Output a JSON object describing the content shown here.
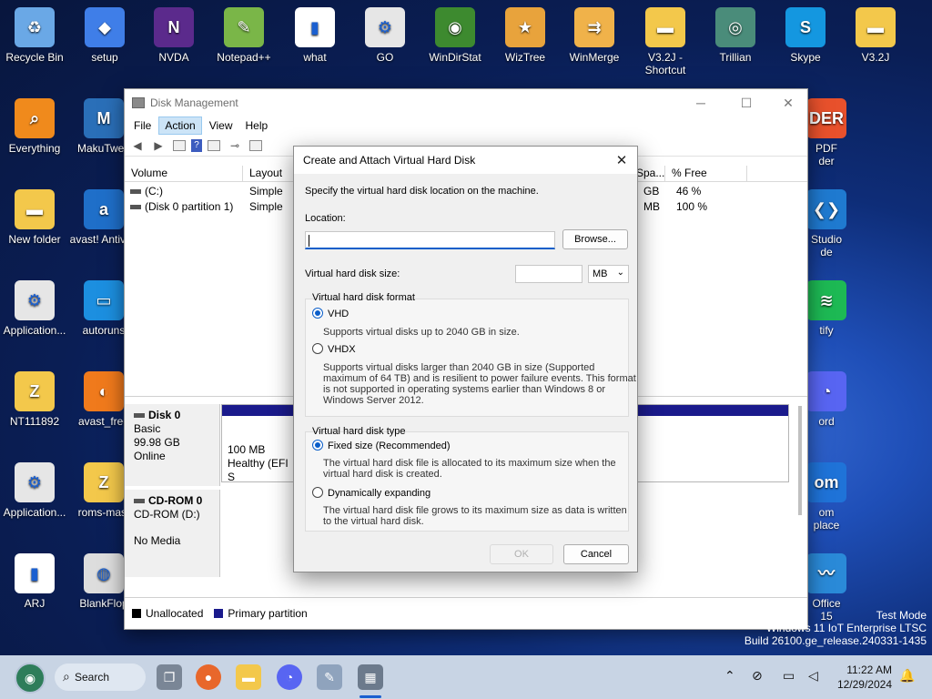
{
  "desktop": {
    "icons_top": [
      {
        "label": "Recycle Bin",
        "glyph": "♻",
        "color": "#6aa8e6"
      },
      {
        "label": "setup",
        "glyph": "◆",
        "color": "#3f7ee8"
      },
      {
        "label": "NVDA",
        "glyph": "N",
        "color": "#5b2a8c"
      },
      {
        "label": "Notepad++",
        "glyph": "✎",
        "color": "#7ab648"
      },
      {
        "label": "what",
        "glyph": "▮",
        "color": "#ffffff"
      },
      {
        "label": "GO",
        "glyph": "⚙",
        "color": "#e6e6e6"
      },
      {
        "label": "WinDirStat",
        "glyph": "◉",
        "color": "#3d8a2f"
      },
      {
        "label": "WizTree",
        "glyph": "★",
        "color": "#e8a33c"
      },
      {
        "label": "WinMerge",
        "glyph": "⇉",
        "color": "#f0b24a"
      },
      {
        "label": "V3.2J - Shortcut",
        "glyph": "▬",
        "color": "#f3c84b"
      },
      {
        "label": "Trillian",
        "glyph": "◎",
        "color": "#4a8c7a"
      },
      {
        "label": "Skype",
        "glyph": "S",
        "color": "#1497e0"
      },
      {
        "label": "V3.2J",
        "glyph": "▬",
        "color": "#f3c84b"
      }
    ],
    "icons_left": [
      {
        "label": "Everything",
        "glyph": "⌕",
        "color": "#f08a1c"
      },
      {
        "label": "MakuTwea",
        "glyph": "M",
        "color": "#2a6fb8"
      },
      {
        "label": "New folder",
        "glyph": "▬",
        "color": "#f3c84b"
      },
      {
        "label": "avast! Antiviru",
        "glyph": "a",
        "color": "#1f6fc9"
      },
      {
        "label": "Application...",
        "glyph": "⚙",
        "color": "#e6e6e6"
      },
      {
        "label": "autoruns",
        "glyph": "▭",
        "color": "#1c8fe0"
      },
      {
        "label": "NT111892",
        "glyph": "Z",
        "color": "#f3c84b"
      },
      {
        "label": "avast_free",
        "glyph": "◐",
        "color": "#f07a1c"
      },
      {
        "label": "Application...",
        "glyph": "⚙",
        "color": "#e6e6e6"
      },
      {
        "label": "roms-mast",
        "glyph": "Z",
        "color": "#f3c84b"
      },
      {
        "label": "ARJ",
        "glyph": "▮",
        "color": "#ffffff"
      },
      {
        "label": "BlankFlop",
        "glyph": "◍",
        "color": "#dddddd"
      }
    ],
    "icons_right": [
      {
        "label": "PDF\nder",
        "glyph": "DER",
        "color": "#e8512c"
      },
      {
        "label": "Studio\nde",
        "glyph": "❮❯",
        "color": "#1f7ad0"
      },
      {
        "label": "tify",
        "glyph": "≋",
        "color": "#1db954"
      },
      {
        "label": "ord",
        "glyph": "◔",
        "color": "#5865f2"
      },
      {
        "label": "om\nplace",
        "glyph": "om",
        "color": "#1f73d8"
      },
      {
        "label": "Office\n15",
        "glyph": "〰",
        "color": "#2a8ad8"
      }
    ],
    "watermark": {
      "line1": "Test Mode",
      "line2": "Windows 11 IoT Enterprise LTSC",
      "line3": "Build 26100.ge_release.240331-1435"
    }
  },
  "window": {
    "title": "Disk Management",
    "menu": [
      "File",
      "Action",
      "View",
      "Help"
    ],
    "active_menu": "Action",
    "columns": [
      "Volume",
      "Layout"
    ],
    "columns_right": [
      "Spa...",
      "% Free"
    ],
    "volumes": [
      {
        "name": "(C:)",
        "layout": "Simple",
        "space": "GB",
        "free": "46 %"
      },
      {
        "name": "(Disk 0 partition 1)",
        "layout": "Simple",
        "space": "MB",
        "free": "100 %"
      }
    ],
    "disks": [
      {
        "name": "Disk 0",
        "type": "Basic",
        "size": "99.98 GB",
        "status": "Online"
      },
      {
        "name": "CD-ROM 0",
        "type": "CD-ROM (D:)",
        "size": "",
        "status": "No Media"
      }
    ],
    "partition": {
      "size": "100 MB",
      "status": "Healthy (EFI S"
    },
    "legend": [
      "Unallocated",
      "Primary partition"
    ]
  },
  "dialog": {
    "title": "Create and Attach Virtual Hard Disk",
    "instruction": "Specify the virtual hard disk location on the machine.",
    "location_label": "Location:",
    "location_value": "",
    "browse_label": "Browse...",
    "size_label": "Virtual hard disk size:",
    "size_value": "",
    "size_unit": "MB",
    "format_group": "Virtual hard disk format",
    "vhd_label": "VHD",
    "vhd_desc": "Supports virtual disks up to 2040 GB in size.",
    "vhdx_label": "VHDX",
    "vhdx_desc1": "Supports virtual disks larger than 2040 GB in size (Supported",
    "vhdx_desc2": "maximum of 64 TB) and is resilient to power failure events. This format",
    "vhdx_desc3": "is not supported in operating systems earlier than Windows 8 or",
    "vhdx_desc4": "Windows Server 2012.",
    "type_group": "Virtual hard disk type",
    "fixed_label": "Fixed size (Recommended)",
    "fixed_desc1": "The virtual hard disk file is allocated to its maximum size when the",
    "fixed_desc2": "virtual hard disk is created.",
    "dynamic_label": "Dynamically expanding",
    "dynamic_desc1": "The virtual hard disk file grows to its maximum size as data is written",
    "dynamic_desc2": "to the virtual hard disk.",
    "ok_label": "OK",
    "cancel_label": "Cancel"
  },
  "taskbar": {
    "search_label": "Search",
    "time": "11:22 AM",
    "date": "12/29/2024"
  }
}
